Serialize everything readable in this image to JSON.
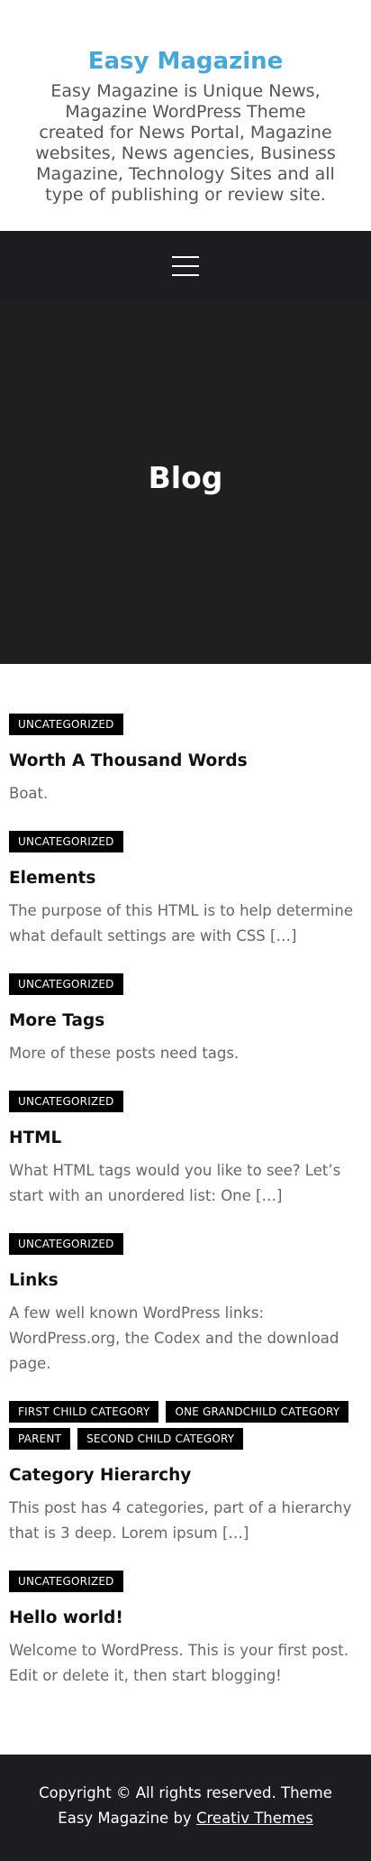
{
  "site": {
    "title": "Easy Magazine",
    "description": "Easy Magazine is Unique News, Magazine WordPress Theme created for News Portal, Magazine websites, News agencies, Business Magazine, Technology Sites and all type of publishing or review site."
  },
  "nav": {
    "menu_icon": "hamburger-menu-icon"
  },
  "hero": {
    "title": "Blog"
  },
  "posts": [
    {
      "categories": [
        "UNCATEGORIZED"
      ],
      "title": "Worth A Thousand Words",
      "excerpt": "Boat."
    },
    {
      "categories": [
        "UNCATEGORIZED"
      ],
      "title": "Elements",
      "excerpt": "The purpose of this HTML is to help determine what default settings are with CSS […]"
    },
    {
      "categories": [
        "UNCATEGORIZED"
      ],
      "title": "More Tags",
      "excerpt": "More of these posts need tags."
    },
    {
      "categories": [
        "UNCATEGORIZED"
      ],
      "title": "HTML",
      "excerpt": "What HTML tags would you like to see? Let’s start with an unordered list: One […]"
    },
    {
      "categories": [
        "UNCATEGORIZED"
      ],
      "title": "Links",
      "excerpt": "A few well known WordPress links: WordPress.org, the Codex and the download page."
    },
    {
      "categories": [
        "FIRST CHILD CATEGORY",
        "ONE GRANDCHILD CATEGORY",
        "PARENT",
        "SECOND CHILD CATEGORY"
      ],
      "title": "Category Hierarchy",
      "excerpt": "This post has 4 categories, part of a hierarchy that is 3 deep. Lorem ipsum […]"
    },
    {
      "categories": [
        "UNCATEGORIZED"
      ],
      "title": "Hello world!",
      "excerpt": "Welcome to WordPress. This is your first post. Edit or delete it, then start blogging!"
    }
  ],
  "footer": {
    "copyright_text": "Copyright © All rights reserved. Theme Easy Magazine by ",
    "credit_link": "Creativ Themes"
  },
  "colors": {
    "accent": "#46a7d8",
    "dark_bg": "#1c1d20",
    "badge_bg": "#000000"
  }
}
